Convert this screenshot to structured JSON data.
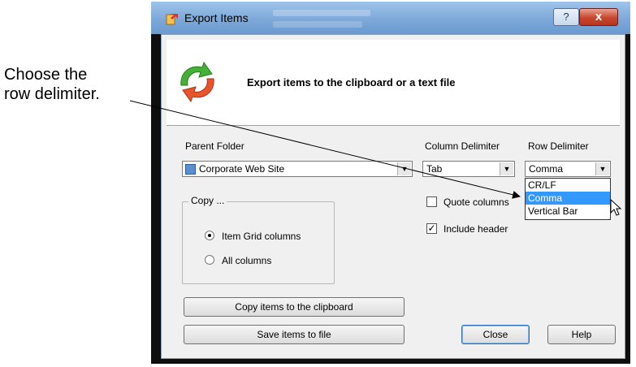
{
  "annotation": {
    "line1": "Choose the",
    "line2": "row delimiter."
  },
  "window": {
    "title": "Export Items",
    "help_button": "?",
    "close_button": "x"
  },
  "header": {
    "text": "Export items to the clipboard or a text file"
  },
  "parent_folder": {
    "label": "Parent Folder",
    "value": "Corporate Web Site"
  },
  "column_delimiter": {
    "label": "Column Delimiter",
    "value": "Tab"
  },
  "row_delimiter": {
    "label": "Row Delimiter",
    "value": "Comma",
    "options": [
      "CR/LF",
      "Comma",
      "Vertical Bar"
    ],
    "highlighted_option": "Comma"
  },
  "options": {
    "quote_columns": {
      "label": "Quote columns",
      "checked": false
    },
    "include_header": {
      "label": "Include header",
      "checked": true
    }
  },
  "copy_group": {
    "title": "Copy ...",
    "item_grid_columns": {
      "label": "Item Grid columns",
      "selected": true
    },
    "all_columns": {
      "label": "All columns",
      "selected": false
    }
  },
  "buttons": {
    "copy_clipboard": "Copy items to the clipboard",
    "save_file": "Save items to file",
    "close": "Close",
    "help": "Help"
  },
  "colors": {
    "selection": "#3399ff",
    "title_bar": "#7aa6d8",
    "close_button": "#c8452d"
  }
}
